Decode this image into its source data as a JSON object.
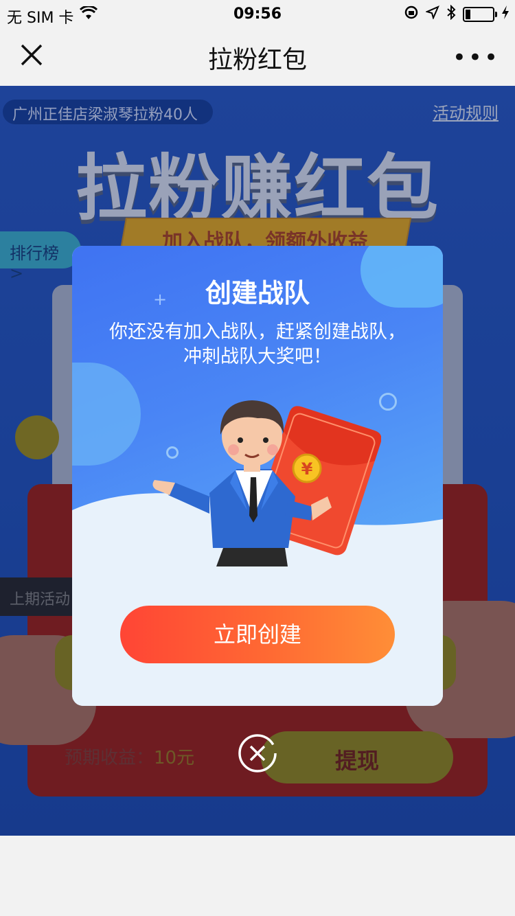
{
  "status_bar": {
    "carrier": "无 SIM 卡",
    "time": "09:56",
    "icons": [
      "wifi-icon",
      "orientation-lock-icon",
      "location-icon",
      "bluetooth-icon",
      "battery-icon",
      "charging-icon"
    ]
  },
  "nav": {
    "title": "拉粉红包",
    "close_icon": "close-icon",
    "more_label": "•••"
  },
  "background_page": {
    "team_pill": "广州正佳店梁淑琴拉粉40人",
    "rules_link": "活动规则",
    "headline": "拉粉赚红包",
    "subtitle": "加入战队，领额外收益",
    "rank_tab": "排行榜>",
    "last_activity": "上期活动",
    "expected_label": "预期收益：",
    "expected_amount": "10元",
    "withdraw_button": "提现"
  },
  "modal": {
    "title": "创建战队",
    "description": "你还没有加入战队，赶紧创建战队，冲刺战队大奖吧！",
    "description_line1": "你还没有加入战队，赶紧创建战队，",
    "description_line2": "冲刺战队大奖吧！",
    "illustration": "businessman-with-red-envelope",
    "currency_symbol": "¥",
    "create_button": "立即创建",
    "close_icon": "close-circle-icon"
  },
  "colors": {
    "modal_sky": "#4a86f5",
    "modal_ground": "#e8f2fb",
    "button_start": "#ff4535",
    "button_end": "#ff8e37",
    "page_blue": "#2454be"
  }
}
